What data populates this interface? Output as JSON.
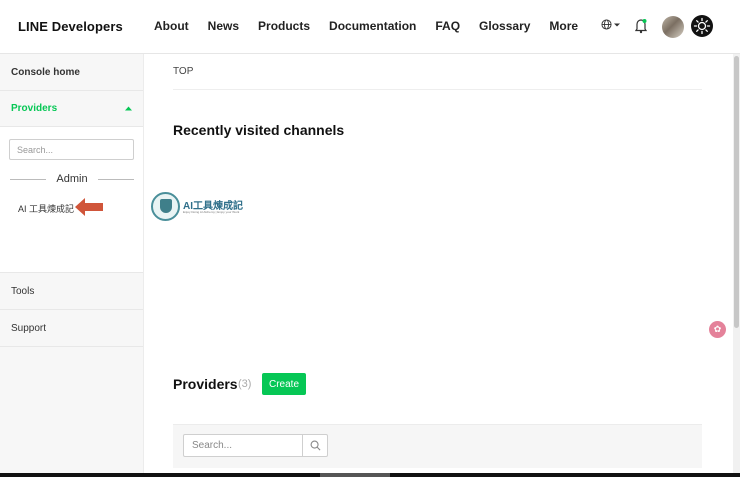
{
  "header": {
    "logo": "LINE Developers",
    "nav": [
      "About",
      "News",
      "Products",
      "Documentation",
      "FAQ",
      "Glossary",
      "More"
    ],
    "language_icon": "globe-icon",
    "notification_icon": "bell-icon",
    "theme_icon": "sun-icon"
  },
  "sidebar": {
    "console_home": "Console home",
    "providers": "Providers",
    "search_placeholder": "Search...",
    "admin_label": "Admin",
    "provider_item": "AI 工具煉成記",
    "tools": "Tools",
    "support": "Support"
  },
  "main": {
    "breadcrumb": "TOP",
    "recent_title": "Recently visited channels",
    "channel": {
      "name": "AI工具煉成記",
      "tagline": "Enjoy Doing AI Alchemy | Enjoy your Work"
    },
    "providers_title": "Providers",
    "providers_count": "(3)",
    "create_label": "Create",
    "search_placeholder": "Search..."
  },
  "colors": {
    "brand_green": "#06c755",
    "annotation_arrow": "#d0553a"
  }
}
